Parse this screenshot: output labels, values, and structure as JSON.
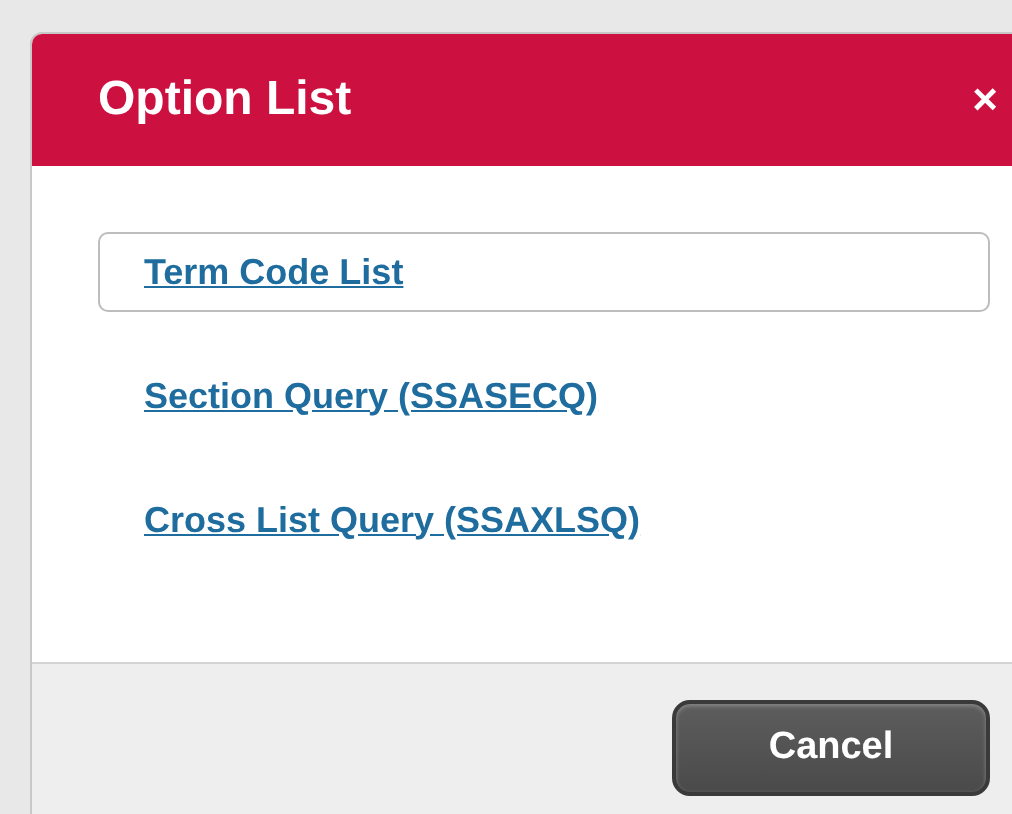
{
  "dialog": {
    "title": "Option List",
    "close": "×"
  },
  "options": [
    {
      "label": "Term Code List",
      "selected": true
    },
    {
      "label": "Section Query (SSASECQ)",
      "selected": false
    },
    {
      "label": "Cross List Query (SSAXLSQ)",
      "selected": false
    }
  ],
  "buttons": [
    "Cancel"
  ]
}
